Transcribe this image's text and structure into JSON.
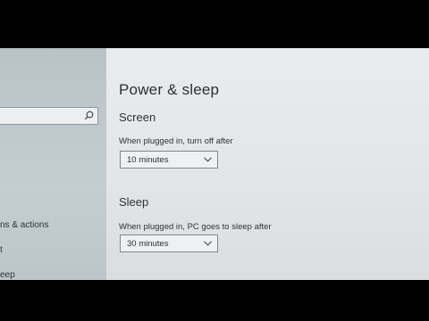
{
  "sidebar": {
    "search": {
      "placeholder": ""
    },
    "items": [
      {
        "label": "ns & actions"
      },
      {
        "label": "t"
      },
      {
        "label": "eep"
      }
    ]
  },
  "main": {
    "title": "Power & sleep",
    "screen": {
      "heading": "Screen",
      "label": "When plugged in, turn off after",
      "value": "10 minutes"
    },
    "sleep": {
      "heading": "Sleep",
      "label": "When plugged in, PC goes to sleep after",
      "value": "30 minutes"
    }
  },
  "icons": {
    "search": "search-icon",
    "dropdown": "chevron-down-icon"
  }
}
